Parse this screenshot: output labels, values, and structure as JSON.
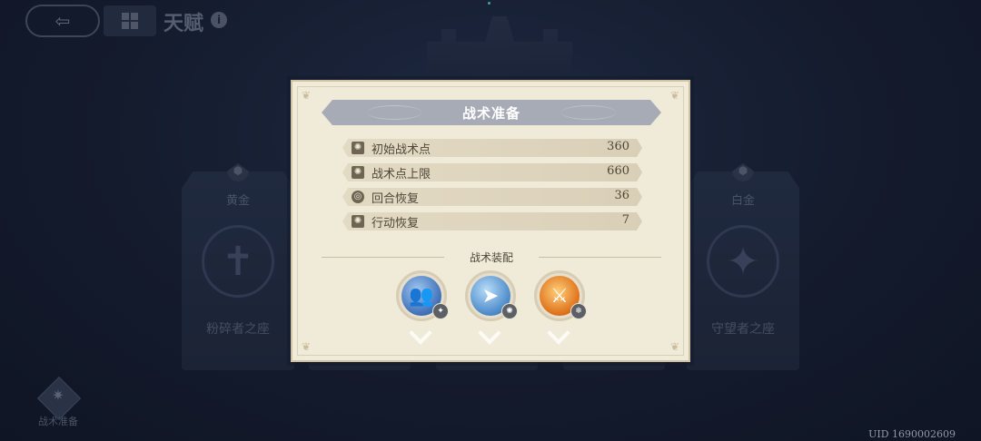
{
  "topbar": {
    "title": "天赋",
    "info_icon": "i"
  },
  "background": {
    "left_card": {
      "tier": "黄金",
      "seat": "粉碎者之座"
    },
    "right_card": {
      "tier": "白金",
      "seat": "守望者之座"
    },
    "tactics_label": "战术准备",
    "uid": "UID 1690002609"
  },
  "modal": {
    "title": "战术准备",
    "stats": [
      {
        "name": "初始战术点",
        "value": "360",
        "icon": "burst-icon"
      },
      {
        "name": "战术点上限",
        "value": "660",
        "icon": "burst-icon"
      },
      {
        "name": "回合恢复",
        "value": "36",
        "icon": "cycle-icon"
      },
      {
        "name": "行动恢复",
        "value": "7",
        "icon": "burst-icon"
      }
    ],
    "equip_title": "战术装配",
    "skills": [
      {
        "icon": "ice-figures-skill-icon",
        "color": "#3e6fb8"
      },
      {
        "icon": "dash-skill-icon",
        "color": "#4a89c9"
      },
      {
        "icon": "fire-sword-skill-icon",
        "color": "#e0761f"
      }
    ]
  },
  "colors": {
    "panel_bg": "#f0ead9",
    "header_band": "#a7abb6",
    "page_bg": "#141b2d"
  }
}
